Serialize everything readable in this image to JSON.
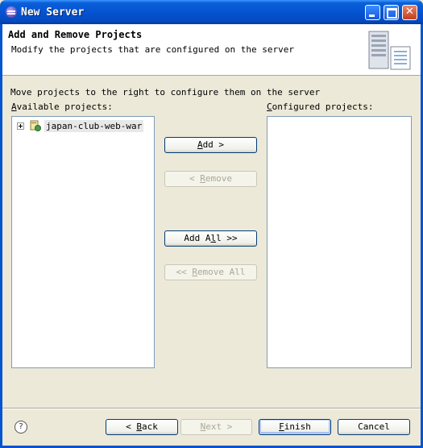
{
  "window": {
    "title": "New Server"
  },
  "header": {
    "title": "Add and Remove Projects",
    "description": "Modify the projects that are configured on the server"
  },
  "instructions": "Move projects to the right to configure them on the server",
  "available": {
    "label_key": "A",
    "label_rest": "vailable projects:",
    "items": [
      {
        "label": "japan-club-web-war",
        "icon": "web-project-icon",
        "expanded": false
      }
    ]
  },
  "configured": {
    "label_key": "C",
    "label_rest": "onfigured projects:",
    "items": []
  },
  "buttons": {
    "add": {
      "pre": "",
      "key": "A",
      "post": "dd >",
      "enabled": true
    },
    "remove": {
      "pre": "< ",
      "key": "R",
      "post": "emove",
      "enabled": false
    },
    "add_all": {
      "pre": "Add A",
      "key": "l",
      "post": "l >>",
      "enabled": true
    },
    "remove_all": {
      "pre": "<< ",
      "key": "R",
      "post": "emove All",
      "enabled": false
    },
    "back": {
      "pre": "< ",
      "key": "B",
      "post": "ack",
      "enabled": true
    },
    "next": {
      "pre": "",
      "key": "N",
      "post": "ext >",
      "enabled": false
    },
    "finish": {
      "pre": "",
      "key": "F",
      "post": "inish",
      "enabled": true
    },
    "cancel": {
      "label": "Cancel",
      "enabled": true
    }
  },
  "help_icon": "?"
}
